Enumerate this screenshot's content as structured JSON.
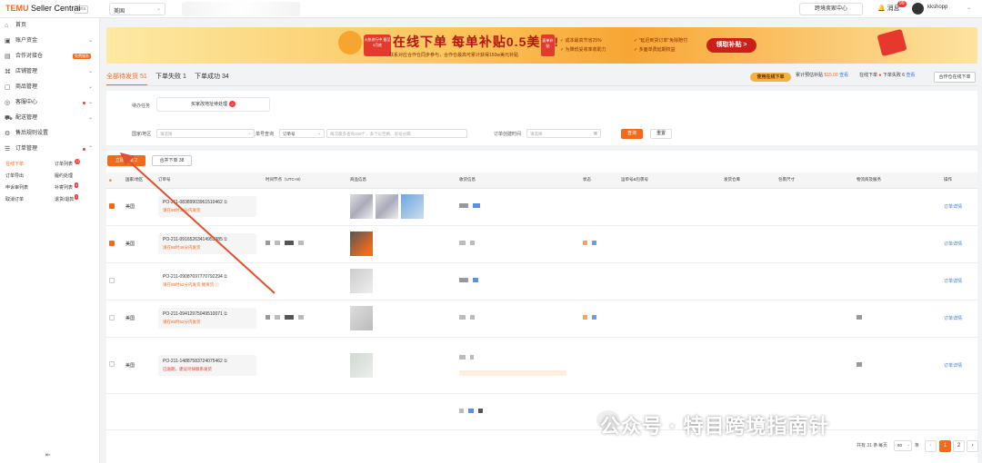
{
  "topbar": {
    "logo_brand": "TEMU",
    "logo_text": "Seller Central",
    "beta": "Beta",
    "region": "美国",
    "cross_border_center": "跨境卖家中心",
    "messages": "消息",
    "message_count": "99",
    "shop_name": "kkshopp"
  },
  "sidebar": {
    "items": [
      {
        "label": "首页",
        "icon": "home-icon"
      },
      {
        "label": "账户资金",
        "icon": "wallet-icon"
      },
      {
        "label": "合作对接仓",
        "icon": "warehouse-icon",
        "tag": "免费服务"
      },
      {
        "label": "店铺管理",
        "icon": "shop-icon"
      },
      {
        "label": "商品管理",
        "icon": "box-icon"
      },
      {
        "label": "客服中心",
        "icon": "headset-icon"
      },
      {
        "label": "配送管理",
        "icon": "truck-icon"
      },
      {
        "label": "售后规则设置",
        "icon": "settings-icon"
      },
      {
        "label": "订单管理",
        "icon": "order-icon"
      }
    ],
    "sub_items": [
      {
        "label": "在线下单",
        "active": true
      },
      {
        "label": "订单列表",
        "badge": "12"
      },
      {
        "label": "订单导出"
      },
      {
        "label": "履约处理"
      },
      {
        "label": "申诉审列表"
      },
      {
        "label": "补寄列表",
        "badge": "4"
      },
      {
        "label": "取消订单"
      },
      {
        "label": "退货/退款",
        "badge": "1"
      }
    ]
  },
  "banner": {
    "tag_left": "火热进行中 截至3月底",
    "headline": "在线下单 每单补贴0.5美元!",
    "subline": "联系对应合作仓同步参与，合作仓最高可累计获得150w美元补贴",
    "tag_right": "面单补贴",
    "points_a": [
      "✓ 成本最高节省25%",
      "✓ 为降低妥收率收助力"
    ],
    "points_b": [
      "✓ \"延迟到货订单\"免除赔付",
      "✓ 多面单费延期权益"
    ],
    "claim": "领取补贴 >"
  },
  "tabs": [
    {
      "label": "全部待发货 51",
      "active": true
    },
    {
      "label": "下单失败 1"
    },
    {
      "label": "下单成功 34"
    }
  ],
  "right_info": {
    "pill": "使用在线下单",
    "subsidy_label": "累计预估补贴",
    "subsidy_value": "$15.00",
    "subsidy_link": "查看",
    "online_order": "在线下单",
    "fail_label": "下单失败",
    "fail_count": "6",
    "fail_link": "查看",
    "coop_btn": "合作仓在线下单"
  },
  "filters": {
    "pending_label": "待办任务",
    "pending_btn": "买家改地址待处理",
    "pending_count": "2",
    "region_label": "国家/地区",
    "region_placeholder": "请选择",
    "order_label": "单号查询",
    "order_type": "订单号",
    "order_placeholder": "每次最多查询100个，多个以空格、逗号分隔",
    "time_label": "订单创建时间",
    "time_placeholder": "请选择",
    "search": "查询",
    "reset": "重置"
  },
  "actions": {
    "place_order": "立即下单 2",
    "merge_order": "合并下单 38"
  },
  "table": {
    "headers": [
      "",
      "国家/地区",
      "订单号",
      "时间节点（UTC+8）",
      "商品信息",
      "收货信息",
      "状态",
      "运单号&包裹号",
      "发货仓库",
      "包裹尺寸",
      "物流商及服务",
      "操作"
    ],
    "rows": [
      {
        "checked": true,
        "region": "美国",
        "order": "PO-211-08389903961510462",
        "warn": "请在88时35分内发货",
        "warn_red": false,
        "action": "订单详情"
      },
      {
        "checked": true,
        "region": "美国",
        "order": "PO-211-09165263414953385",
        "warn": "请在88时46分内发货",
        "warn_red": false,
        "action": "订单详情"
      },
      {
        "checked": false,
        "region": "",
        "order": "PO-211-09087697770792294",
        "warn": "请在88时52分内发货  催发货 ⓘ",
        "warn_red": false,
        "action": "订单详情"
      },
      {
        "checked": false,
        "region": "美国",
        "order": "PO-211-09412975049510071",
        "warn": "请在88时52分内发货",
        "warn_red": false,
        "action": "订单详情"
      },
      {
        "checked": false,
        "region": "美国",
        "order": "PO-211-14887583724075462",
        "warn": "已逾期，建议尽快联系发货",
        "warn_red": true,
        "action": "订单详情"
      }
    ]
  },
  "pagination": {
    "total": "共有 31 条",
    "per_page_label": "每页",
    "per_page": "50",
    "unit": "条",
    "pages": [
      "1",
      "2"
    ]
  },
  "watermark": "公众号 · 特目跨境指南针"
}
